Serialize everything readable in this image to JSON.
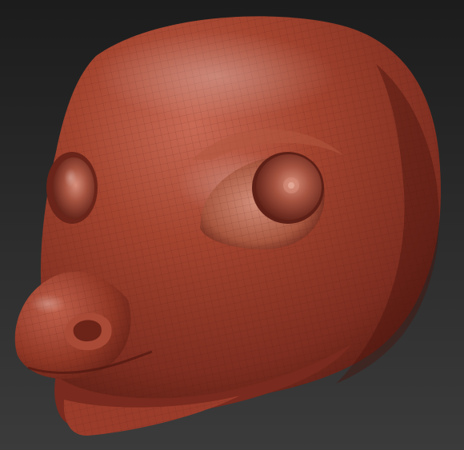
{
  "viewport": {
    "subject": "sculpted-animal-head",
    "colors": {
      "background_top": "#1c1c1c",
      "background_bottom": "#3b3b3b",
      "clay_base": "#9a3b2c",
      "clay_highlight": "#c86a55",
      "clay_shadow": "#5a1d14",
      "clay_rim": "#e08a73",
      "wire": "#3b120c"
    }
  }
}
